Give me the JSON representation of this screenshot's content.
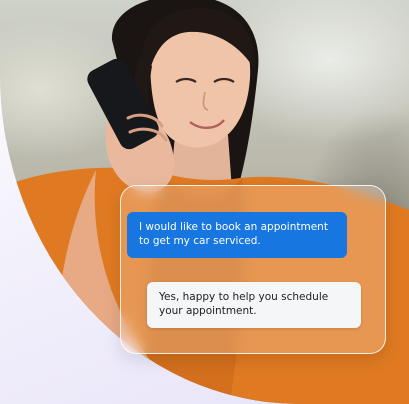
{
  "conversation": {
    "user_message": "I would like to book an appointment to get my car serviced.",
    "agent_message": "Yes, happy to help you schedule your appointment."
  },
  "colors": {
    "user_bubble": "#1776e0",
    "agent_bubble": "#f5f6f8",
    "shirt": "#e07a22",
    "background_tint": "#e8e4fa"
  },
  "icons": {
    "phone": "smartphone-icon"
  }
}
